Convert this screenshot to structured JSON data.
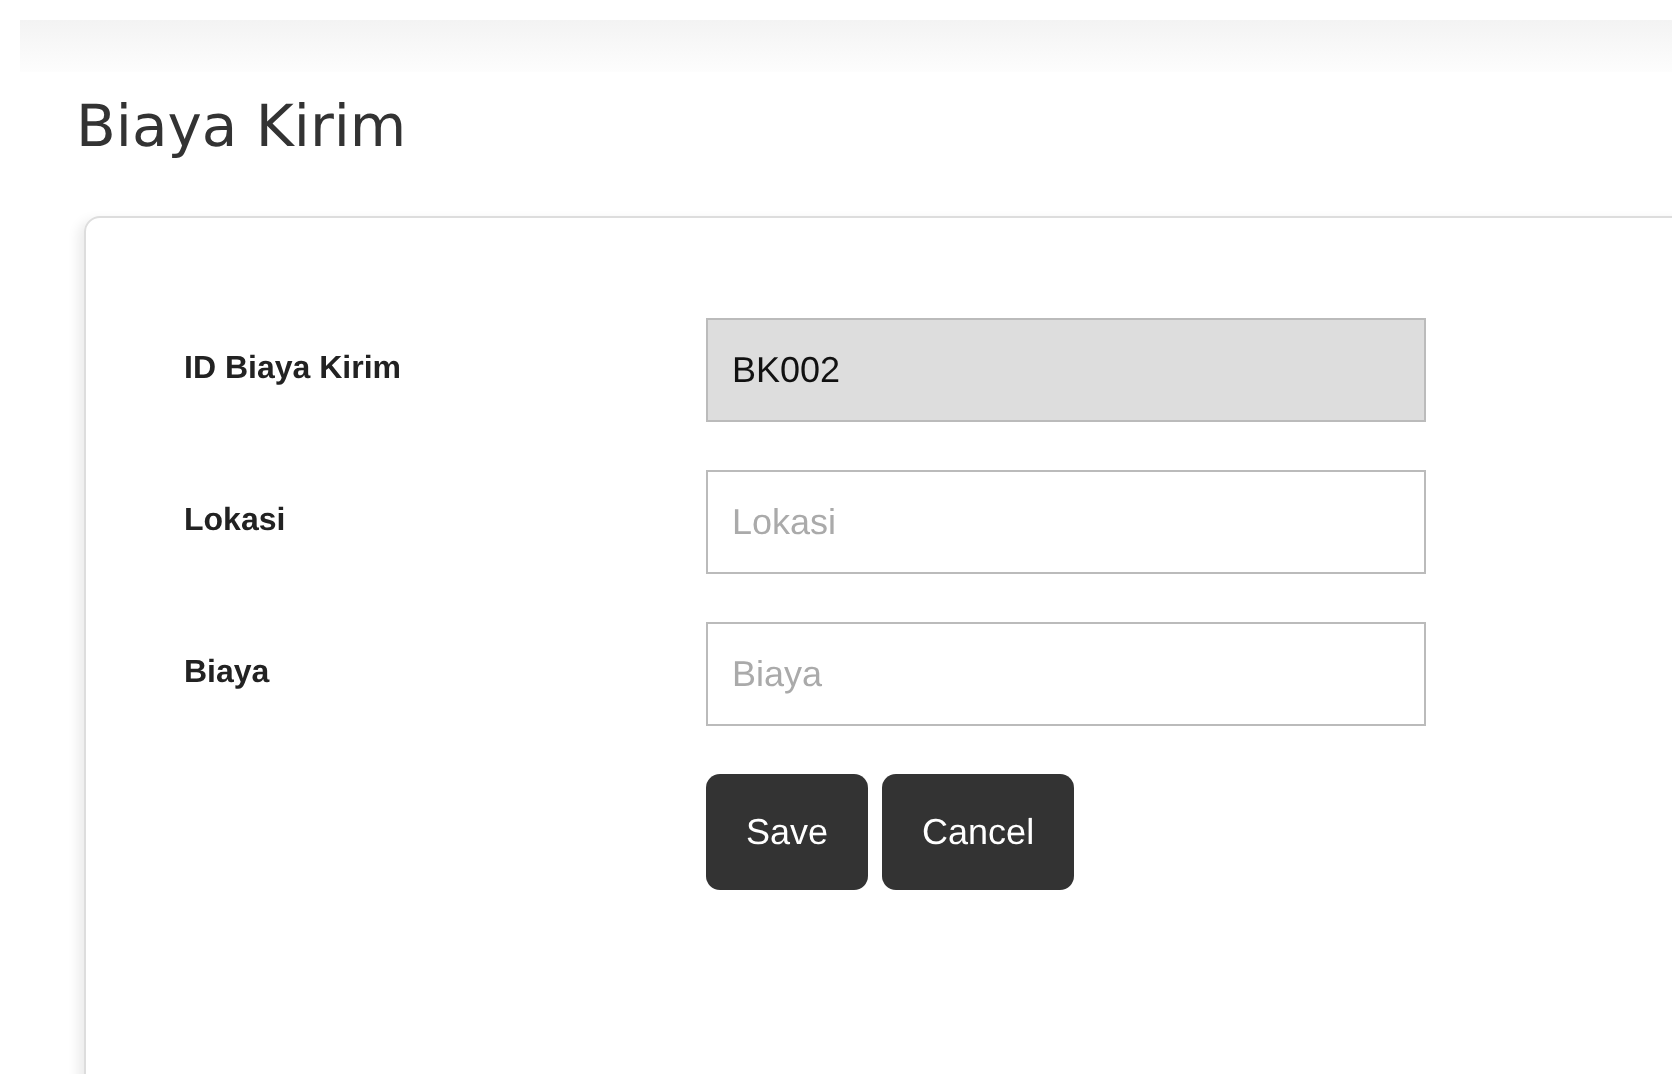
{
  "page": {
    "title": "Biaya Kirim"
  },
  "form": {
    "fields": [
      {
        "label": "ID Biaya Kirim",
        "value": "BK002",
        "disabled": true
      },
      {
        "label": "Lokasi",
        "placeholder": "Lokasi",
        "disabled": false
      },
      {
        "label": "Biaya",
        "placeholder": "Biaya",
        "disabled": false
      }
    ],
    "buttons": [
      "Save",
      "Cancel"
    ]
  }
}
